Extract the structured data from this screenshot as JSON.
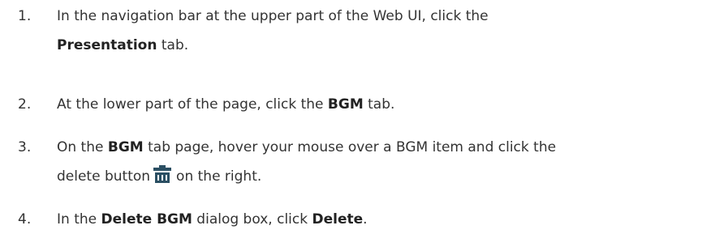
{
  "steps": [
    {
      "number": "1.",
      "line1_pre": "In the navigation bar at the upper part of the Web UI, click the",
      "line2_bold": "Presentation",
      "line2_post": " tab."
    },
    {
      "number": "2.",
      "pre": "At the lower part of the page, click the ",
      "bold": "BGM",
      "post": " tab."
    },
    {
      "number": "3.",
      "line1_pre": "On the ",
      "line1_bold": "BGM",
      "line1_post": " tab page, hover your mouse over a BGM item and click the",
      "line2_pre": "delete button",
      "icon": "trash-delete-icon",
      "line2_post": "on the right."
    },
    {
      "number": "4.",
      "pre": "In the ",
      "bold1": "Delete BGM",
      "mid": " dialog box, click ",
      "bold2": "Delete",
      "post": "."
    }
  ],
  "colors": {
    "text": "#333333",
    "icon": "#2b4f63"
  }
}
